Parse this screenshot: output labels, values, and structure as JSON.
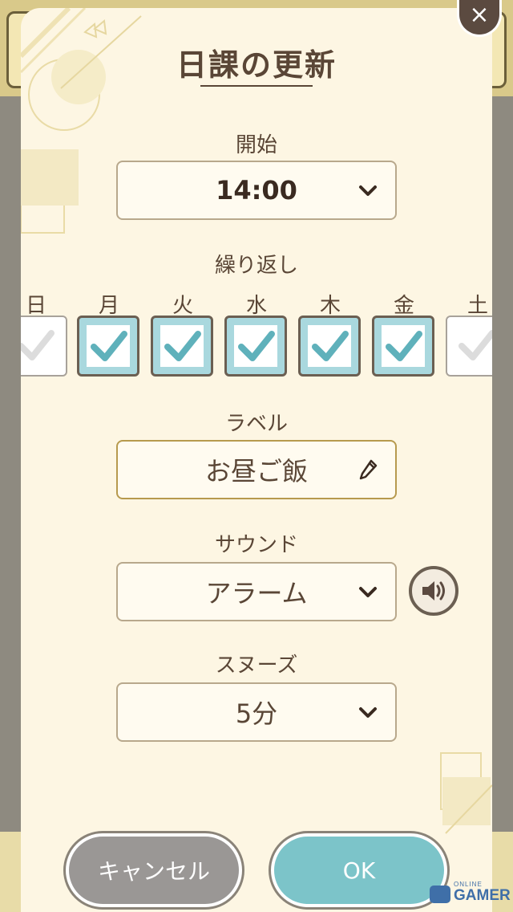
{
  "dialog": {
    "title": "日課の更新",
    "close_label": "×"
  },
  "start": {
    "label": "開始",
    "value": "14:00"
  },
  "repeat": {
    "label": "繰り返し",
    "days": [
      {
        "label": "日",
        "checked": false
      },
      {
        "label": "月",
        "checked": true
      },
      {
        "label": "火",
        "checked": true
      },
      {
        "label": "水",
        "checked": true
      },
      {
        "label": "木",
        "checked": true
      },
      {
        "label": "金",
        "checked": true
      },
      {
        "label": "土",
        "checked": false
      }
    ]
  },
  "label_field": {
    "label": "ラベル",
    "value": "お昼ご飯"
  },
  "sound": {
    "label": "サウンド",
    "value": "アラーム"
  },
  "snooze": {
    "label": "スヌーズ",
    "value": "5分"
  },
  "buttons": {
    "cancel": "キャンセル",
    "ok": "OK"
  },
  "watermark": {
    "online": "ONLINE",
    "gamer": "GAMER"
  }
}
